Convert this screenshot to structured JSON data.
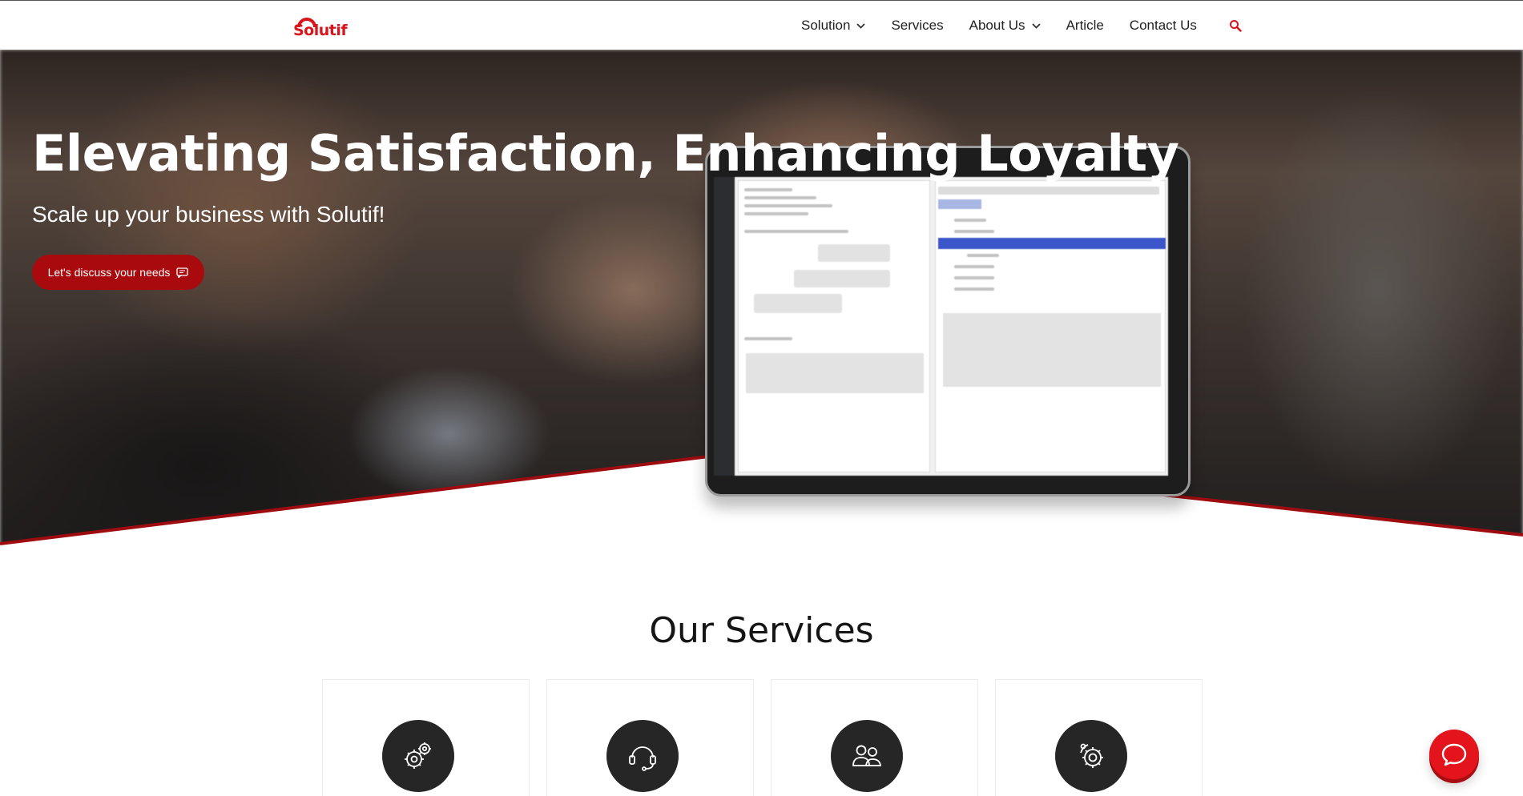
{
  "brand": {
    "logo_text": "Solutif",
    "accent": "#d8141c",
    "dark_red": "#a80a0e"
  },
  "nav": {
    "items": [
      {
        "label": "Solution",
        "dropdown": true
      },
      {
        "label": "Services",
        "dropdown": false
      },
      {
        "label": "About Us",
        "dropdown": true
      },
      {
        "label": "Article",
        "dropdown": false
      },
      {
        "label": "Contact Us",
        "dropdown": false
      }
    ],
    "search_icon": "search-icon"
  },
  "hero": {
    "title": "Elevating Satisfaction, Enhancing Loyalty",
    "subtitle": "Scale up your business with Solutif!",
    "cta_label": "Let's discuss your needs",
    "cta_icon": "chat-lines-icon"
  },
  "services": {
    "title": "Our Services",
    "cards": [
      {
        "icon": "gears-icon"
      },
      {
        "icon": "headset-icon"
      },
      {
        "icon": "users-icon"
      },
      {
        "icon": "settings-icon"
      }
    ]
  },
  "chat_widget": {
    "icon": "chat-bubble-icon"
  }
}
